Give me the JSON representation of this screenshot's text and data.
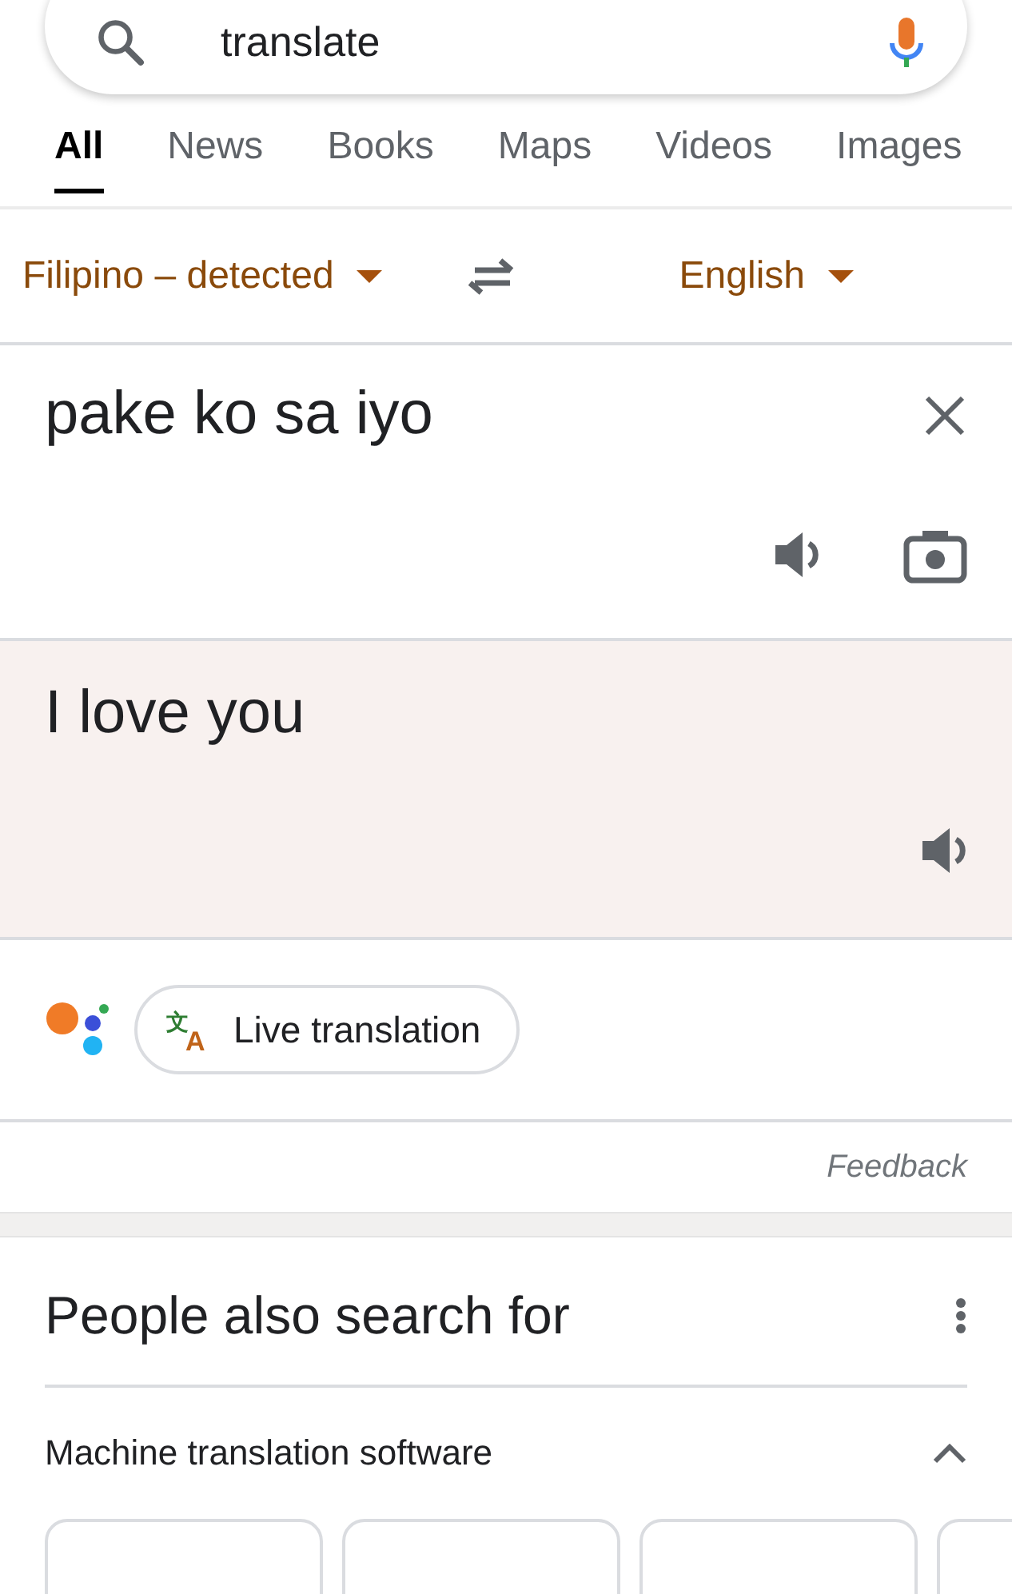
{
  "search": {
    "value": "translate"
  },
  "tabs": [
    {
      "label": "All",
      "selected": true
    },
    {
      "label": "News",
      "selected": false
    },
    {
      "label": "Books",
      "selected": false
    },
    {
      "label": "Maps",
      "selected": false
    },
    {
      "label": "Videos",
      "selected": false
    },
    {
      "label": "Images",
      "selected": false
    }
  ],
  "translator": {
    "source_language": "Filipino – detected",
    "target_language": "English",
    "source_text": "pake ko sa iyo",
    "translation": "I love you"
  },
  "live_translation": {
    "icon_glyphs": [
      "文",
      "A"
    ],
    "label": "Live translation"
  },
  "feedback": "Feedback",
  "people_also_search": {
    "title": "People also search for",
    "group": "Machine translation software",
    "expanded": true
  }
}
